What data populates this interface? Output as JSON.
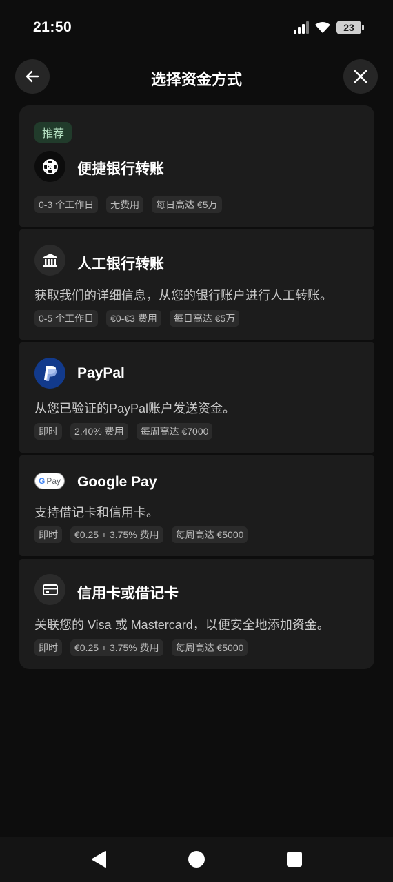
{
  "status_bar": {
    "time": "21:50",
    "battery": "23"
  },
  "header": {
    "title": "选择资金方式"
  },
  "methods": [
    {
      "badge": "推荐",
      "title": "便捷银行转账",
      "icon": "open-banking-icon",
      "chips": [
        "0-3 个工作日",
        "无费用",
        "每日高达 €5万"
      ]
    },
    {
      "title": "人工银行转账",
      "icon": "bank-icon",
      "description": "获取我们的详细信息，从您的银行账户进行人工转账。",
      "chips": [
        "0-5 个工作日",
        "€0-€3 费用",
        "每日高达 €5万"
      ]
    },
    {
      "title": "PayPal",
      "icon": "paypal-icon",
      "description": "从您已验证的PayPal账户发送资金。",
      "chips": [
        "即时",
        "2.40% 费用",
        "每周高达 €7000"
      ]
    },
    {
      "title": "Google Pay",
      "icon": "google-pay-icon",
      "icon_text": [
        "G",
        "Pay"
      ],
      "description": "支持借记卡和信用卡。",
      "chips": [
        "即时",
        "€0.25 + 3.75% 费用",
        "每周高达 €5000"
      ]
    },
    {
      "title": "信用卡或借记卡",
      "icon": "credit-card-icon",
      "description": "关联您的 Visa 或 Mastercard，以便安全地添加资金。",
      "chips": [
        "即时",
        "€0.25 + 3.75% 费用",
        "每周高达 €5000"
      ]
    }
  ],
  "colors": {
    "background": "#0d0d0d",
    "card": "#1c1c1c",
    "badge_bg": "#213b2b",
    "badge_text": "#b7e3c4",
    "paypal_blue": "#123a8c"
  }
}
